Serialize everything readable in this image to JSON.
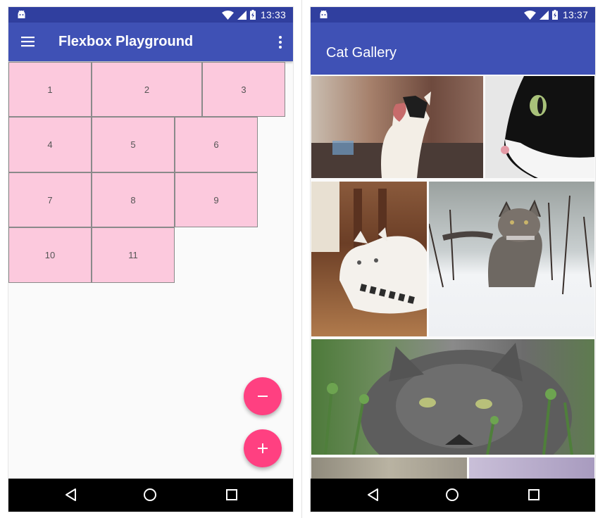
{
  "left_screen": {
    "status_time": "13:33",
    "title": "Flexbox Playground",
    "items": [
      "1",
      "2",
      "3",
      "4",
      "5",
      "6",
      "7",
      "8",
      "9",
      "10",
      "11"
    ],
    "fab_remove_symbol": "−",
    "fab_add_symbol": "+"
  },
  "right_screen": {
    "status_time": "13:37",
    "title": "Cat Gallery"
  },
  "colors": {
    "primary": "#3f51b5",
    "primary_dark": "#303f9f",
    "accent": "#ff4081",
    "flex_item": "#fcc9dd"
  },
  "icons": [
    "android-icon",
    "wifi-icon",
    "signal-icon",
    "battery-charging-icon",
    "menu-icon",
    "more-vert-icon",
    "back-icon",
    "home-icon",
    "recents-icon"
  ]
}
